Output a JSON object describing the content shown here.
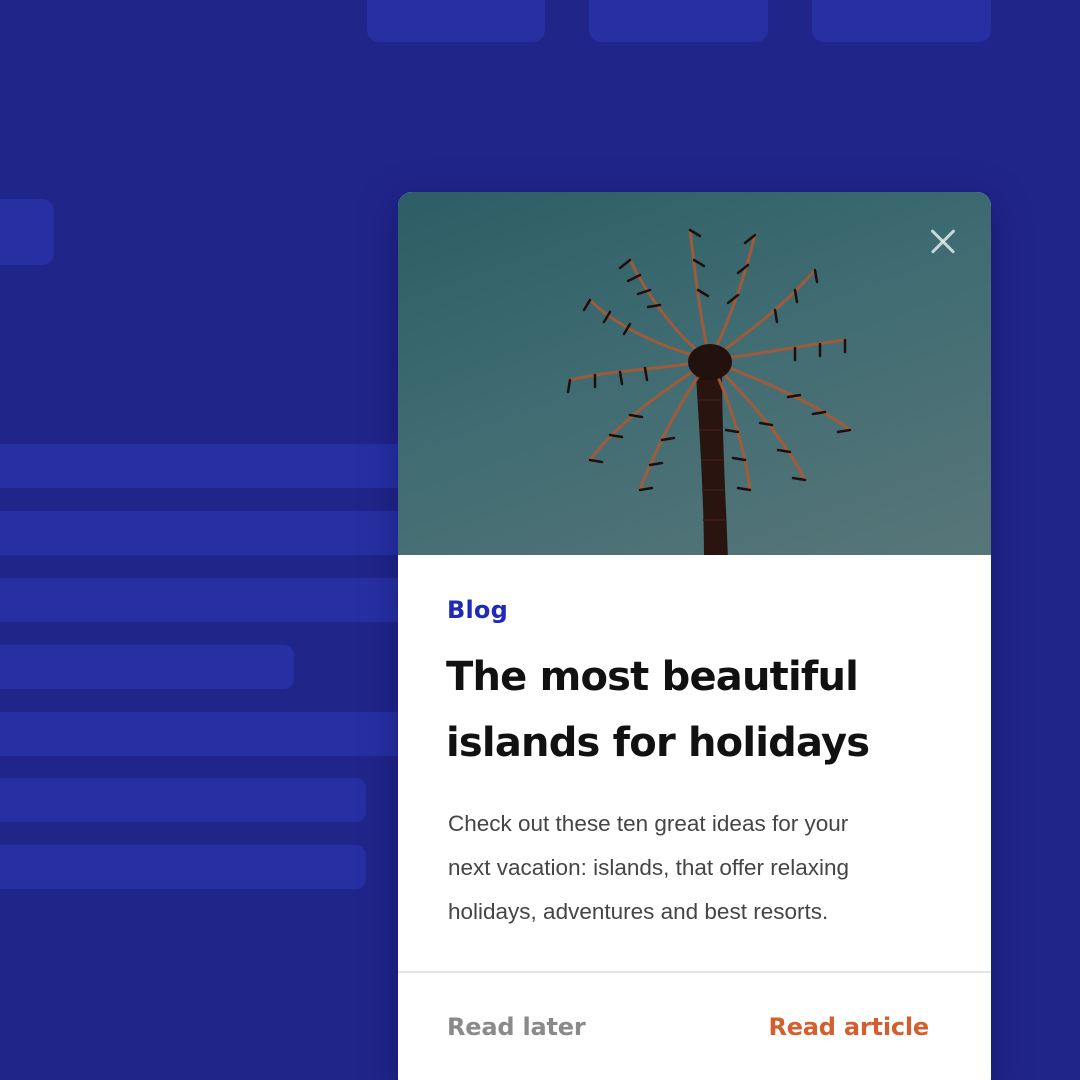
{
  "background": {
    "color": "#20258a",
    "placeholder_color": "#2630a3"
  },
  "card": {
    "image": {
      "subject": "palm tree against a teal sky",
      "icon": "palm-tree-photo"
    },
    "close_icon": "close-icon",
    "category": "Blog",
    "title_line_1": "The most beautiful",
    "title_line_2": "islands for holidays",
    "description_line_1": "Check out these ten great ideas for your",
    "description_line_2": "next vacation: islands, that offer relaxing",
    "description_line_3": "holidays, adventures and best resorts.",
    "actions": {
      "secondary_label": "Read later",
      "primary_label": "Read article"
    },
    "colors": {
      "category": "#1f2bb8",
      "primary_action": "#d35f2e",
      "secondary_action": "#8a8a8a"
    }
  }
}
